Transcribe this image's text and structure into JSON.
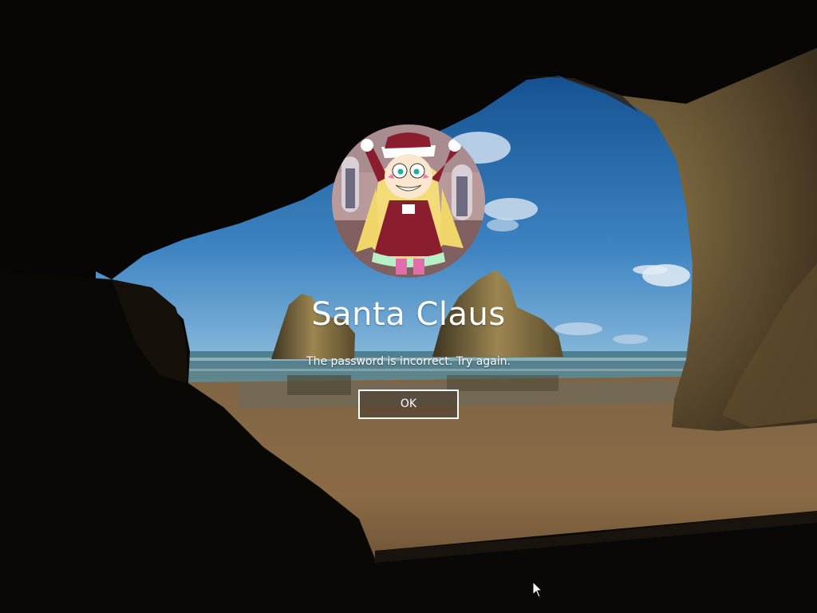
{
  "lock_screen": {
    "user_name": "Santa Claus",
    "error_message": "The password is incorrect. Try again.",
    "ok_label": "OK"
  },
  "avatar": {
    "icon": "user-avatar-cartoon-icon"
  },
  "background": {
    "scene": "sea-cave-arch-wallpaper",
    "colors": {
      "sky_top": "#1d5a98",
      "sky_bottom": "#7fb2d8",
      "sea": "#3f6f86",
      "sand": "#8a6a45",
      "rock": "#6a5636",
      "cave_dark": "#0a0805"
    }
  },
  "pointer": {
    "icon": "mouse-cursor-icon"
  }
}
